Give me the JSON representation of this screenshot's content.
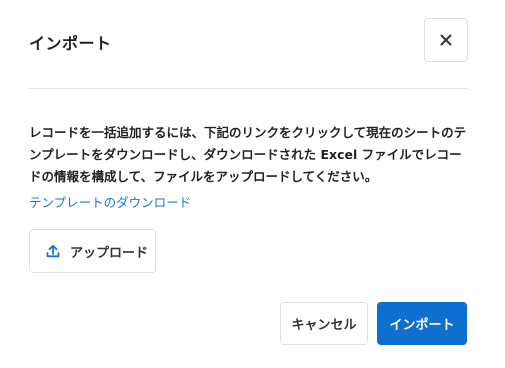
{
  "dialog": {
    "title": "インポート",
    "close_icon": "close-icon"
  },
  "body": {
    "description": "レコードを一括追加するには、下記のリンクをクリックして現在のシートのテンプレートをダウンロードし、ダウンロードされた Excel ファイルでレコードの情報を構成して、ファイルをアップロードしてください。",
    "template_link": "テンプレートのダウンロード",
    "upload_button": "アップロード",
    "upload_icon": "upload-icon"
  },
  "footer": {
    "cancel_button": "キャンセル",
    "import_button": "インポート"
  },
  "colors": {
    "primary": "#0f6fd0",
    "link": "#1576d2",
    "border": "#e1e1e1"
  }
}
